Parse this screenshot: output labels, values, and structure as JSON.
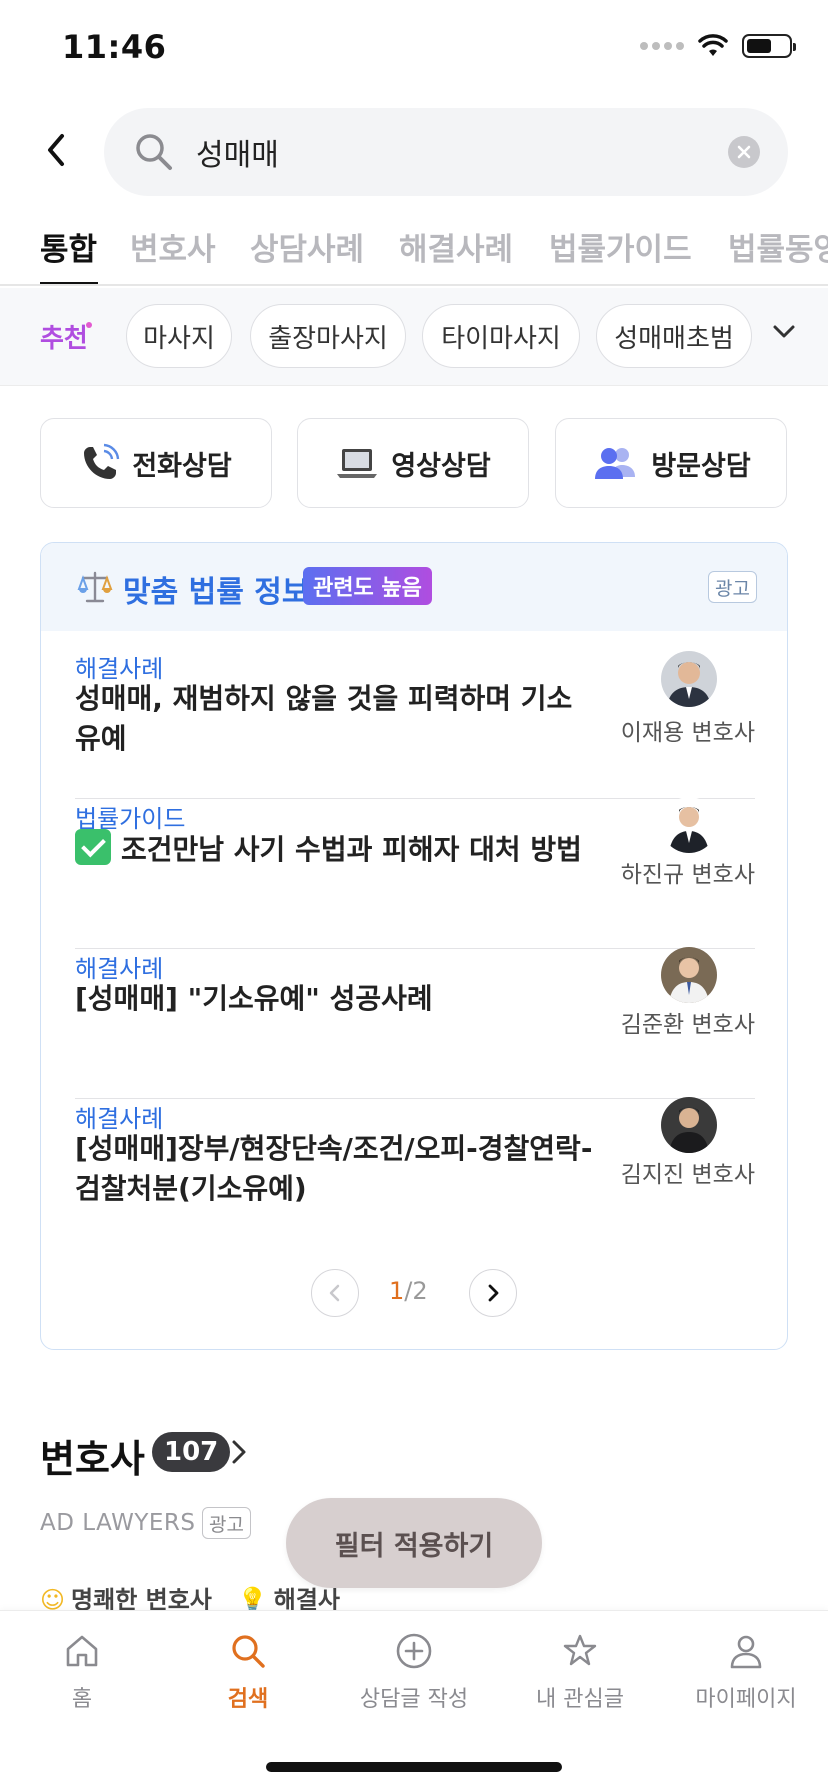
{
  "status_bar": {
    "time": "11:46"
  },
  "search": {
    "query": "성매매"
  },
  "tabs": [
    {
      "label": "통합",
      "active": true
    },
    {
      "label": "변호사"
    },
    {
      "label": "상담사례"
    },
    {
      "label": "해결사례"
    },
    {
      "label": "법률가이드"
    },
    {
      "label": "법률동영상"
    }
  ],
  "chips": {
    "recommend_label": "추천",
    "items": [
      "마사지",
      "출장마사지",
      "타이마사지",
      "성매매초범"
    ]
  },
  "consult": [
    {
      "label": "전화상담",
      "icon": "phone-icon"
    },
    {
      "label": "영상상담",
      "icon": "laptop-icon"
    },
    {
      "label": "방문상담",
      "icon": "people-icon"
    }
  ],
  "info_card": {
    "title": "맞춤 법률 정보",
    "badge": "관련도 높음",
    "ad_label": "광고",
    "items": [
      {
        "category": "해결사례",
        "title": "성매매, 재범하지 않을 것을 피력하며 기소유예",
        "lawyer": "이재용 변호사"
      },
      {
        "category": "법률가이드",
        "title": "조건만남 사기 수법과 피해자 대처 방법",
        "lawyer": "하진규 변호사"
      },
      {
        "category": "해결사례",
        "title": "[성매매] \"기소유예\" 성공사례",
        "lawyer": "김준환 변호사"
      },
      {
        "category": "해결사례",
        "title": "[성매매]장부/현장단속/조건/오피-경찰연락-검찰처분(기소유예)",
        "lawyer": "김지진 변호사"
      }
    ],
    "pager": {
      "current": "1",
      "total": "/2"
    }
  },
  "lawyers": {
    "heading": "변호사",
    "count": "107",
    "ad_label": "AD LAWYERS",
    "ad_badge": "광고",
    "tags": [
      "명쾌한 변호사",
      "해결사"
    ]
  },
  "filter_button": "필터 적용하기",
  "bottom_nav": [
    {
      "label": "홈",
      "icon": "home-icon"
    },
    {
      "label": "검색",
      "icon": "search-icon",
      "active": true
    },
    {
      "label": "상담글 작성",
      "icon": "plus-circle-icon"
    },
    {
      "label": "내 관심글",
      "icon": "star-icon"
    },
    {
      "label": "마이페이지",
      "icon": "person-icon"
    }
  ],
  "colors": {
    "accent": "#e0701f",
    "link_blue": "#2f6fe0",
    "recommend_purple": "#b04de0"
  }
}
